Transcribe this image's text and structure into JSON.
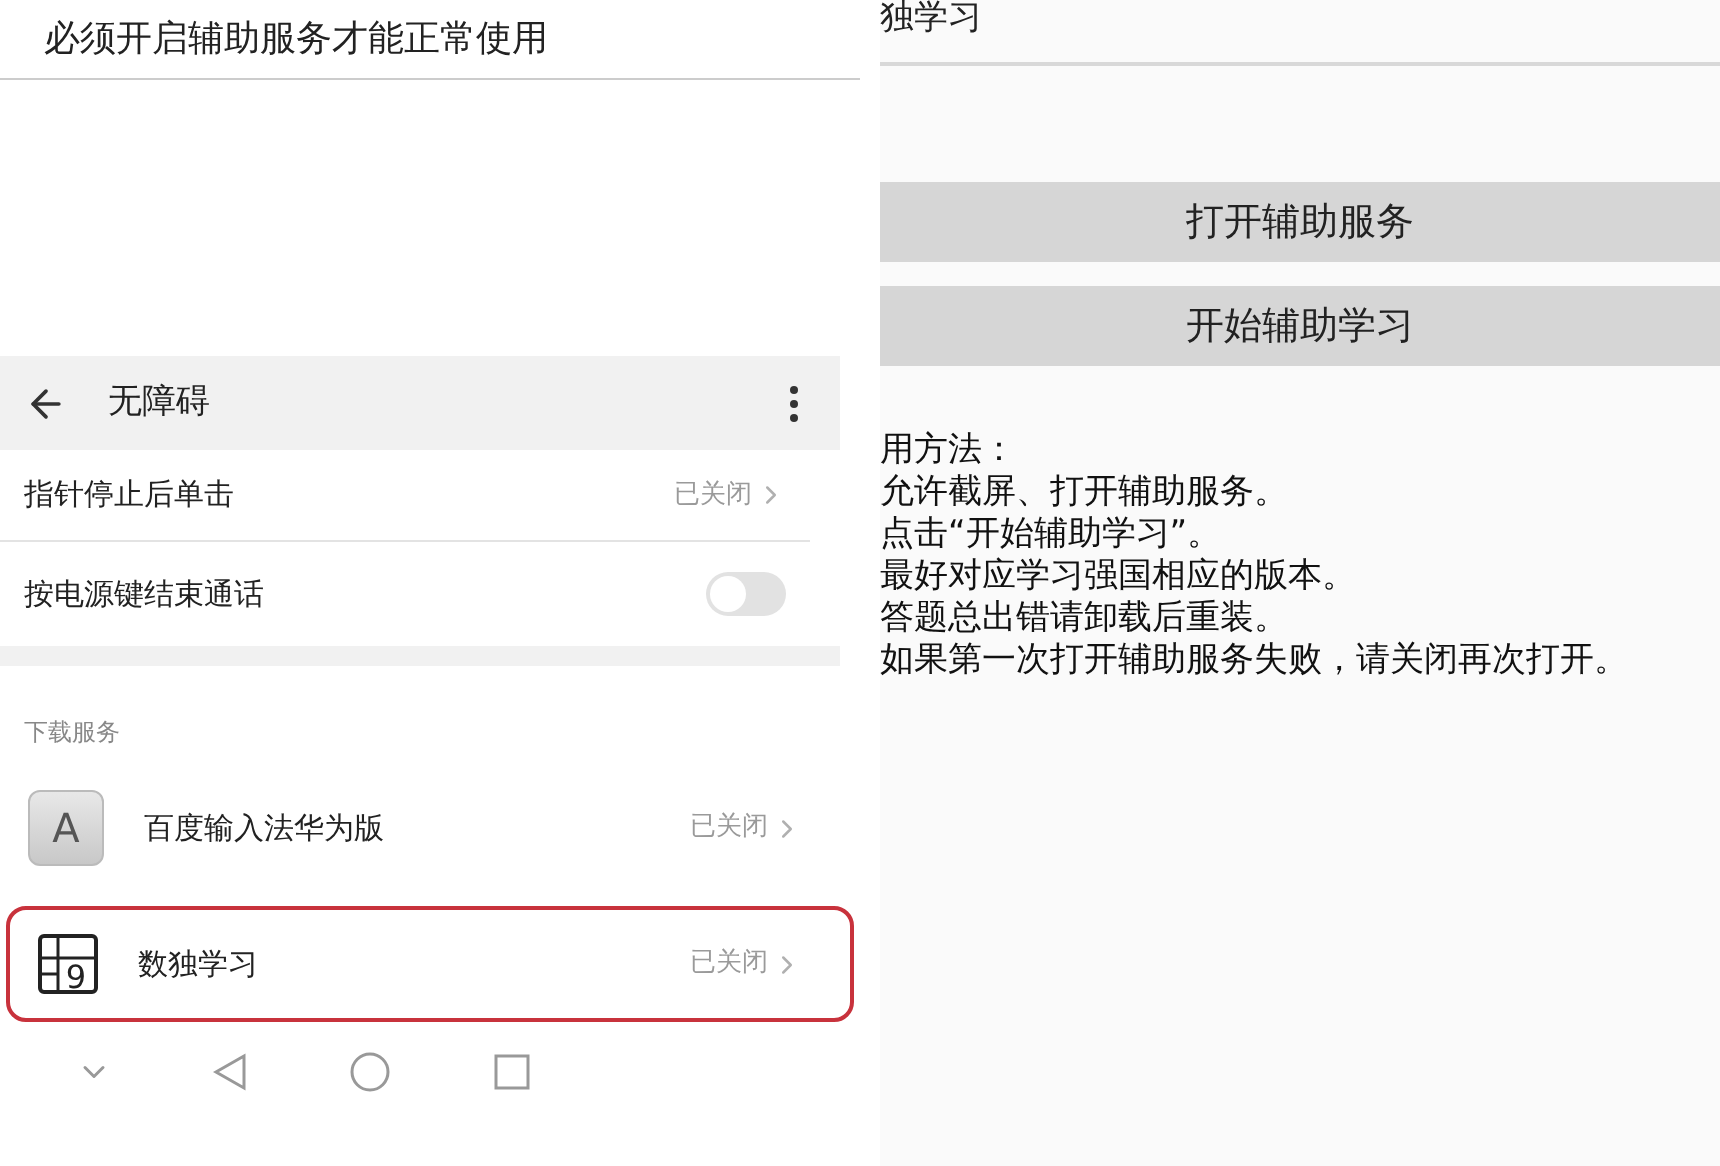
{
  "left": {
    "banner": "必须开启辅助服务才能正常使用",
    "header": {
      "title": "无障碍"
    },
    "rows": [
      {
        "kind": "link",
        "label": "指针停止后单击",
        "value": "已关闭"
      },
      {
        "kind": "switch",
        "label": "按电源键结束通话",
        "on": false
      }
    ],
    "section": "下载服务",
    "services": [
      {
        "kind": "letter",
        "icon_text": "A",
        "label": "百度输入法华为版",
        "value": "已关闭",
        "circled": false
      },
      {
        "kind": "sudoku",
        "icon_text": "9",
        "label": "数独学习",
        "value": "已关闭",
        "circled": true
      }
    ]
  },
  "right": {
    "title": "独学习",
    "buttons": [
      "打开辅助服务",
      "开始辅助学习"
    ],
    "instructions": [
      "用方法：",
      "允许截屏、打开辅助服务。",
      "点击“开始辅助学习”。",
      "最好对应学习强国相应的版本。",
      "答题总出错请卸载后重装。",
      "如果第一次打开辅助服务失败，请关闭再次打开。"
    ]
  }
}
